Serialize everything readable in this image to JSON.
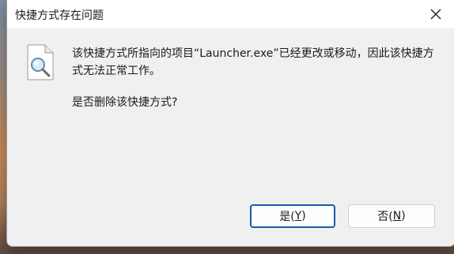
{
  "dialog": {
    "title": "快捷方式存在问题",
    "message": "该快捷方式所指向的项目“Launcher.exe”已经更改或移动，因此该快捷方式无法正常工作。",
    "question": "是否删除该快捷方式?",
    "icon": "document-search-icon",
    "close_icon": "close-icon"
  },
  "buttons": {
    "yes_prefix": "是(",
    "yes_key": "Y",
    "yes_suffix": ")",
    "no_prefix": "否(",
    "no_key": "N",
    "no_suffix": ")"
  },
  "colors": {
    "dialog_bg": "#f0f0f0",
    "titlebar_bg": "#ffffff",
    "default_button_border": "#1f5aa6"
  }
}
